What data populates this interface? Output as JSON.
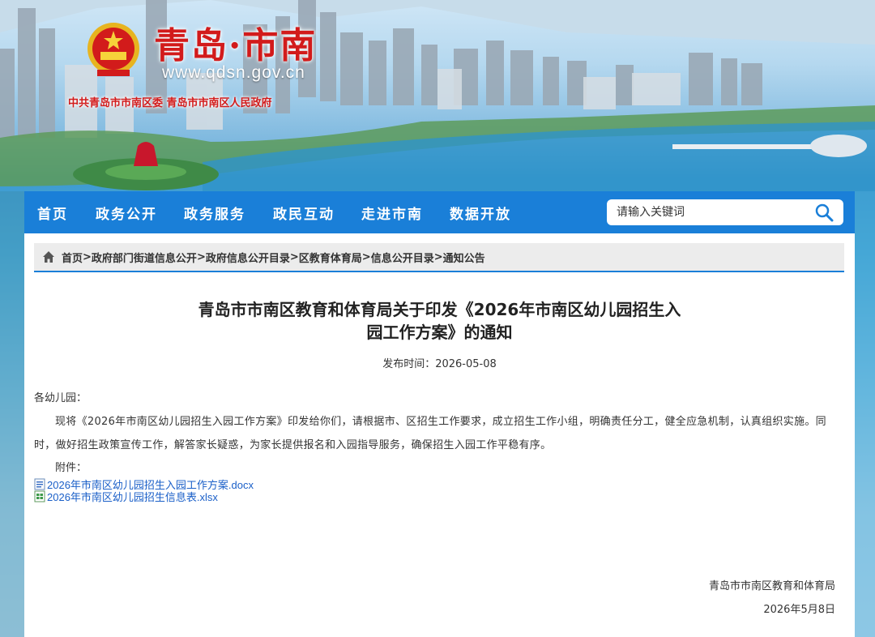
{
  "header": {
    "site_title": "青岛·市南",
    "site_url": "www.qdsn.gov.cn",
    "orgs": "中共青岛市市南区委  青岛市市南区人民政府"
  },
  "nav": {
    "items": [
      "首页",
      "政务公开",
      "政务服务",
      "政民互动",
      "走进市南",
      "数据开放"
    ]
  },
  "search": {
    "placeholder": "请输入关键词"
  },
  "breadcrumb": {
    "items": [
      "首页",
      "政府部门街道信息公开",
      "政府信息公开目录",
      "区教育体育局",
      "信息公开目录",
      "通知公告"
    ],
    "separator": ">"
  },
  "article": {
    "title_line1": "青岛市市南区教育和体育局关于印发《2026年市南区幼儿园招生入",
    "title_line2": "园工作方案》的通知",
    "date_label": "发布时间：",
    "date": "2026-05-08",
    "greeting": "各幼儿园：",
    "body": "现将《2026年市南区幼儿园招生入园工作方案》印发给你们，请根据市、区招生工作要求，成立招生工作小组，明确责任分工，健全应急机制，认真组织实施。同时，做好招生政策宣传工作，解答家长疑惑，为家长提供报名和入园指导服务，确保招生入园工作平稳有序。",
    "attachments_label": "附件：",
    "attachments": [
      {
        "name": "2026年市南区幼儿园招生入园工作方案.docx",
        "icon": "docx-file-icon"
      },
      {
        "name": "2026年市南区幼儿园招生信息表.xlsx",
        "icon": "xlsx-file-icon"
      }
    ],
    "sign_org": "青岛市市南区教育和体育局",
    "sign_date": "2026年5月8日"
  },
  "colors": {
    "nav_blue": "#1a7fd8",
    "title_red": "#d21b1b",
    "link_blue": "#1a5fc8",
    "breadcrumb_bg": "#ececec"
  }
}
